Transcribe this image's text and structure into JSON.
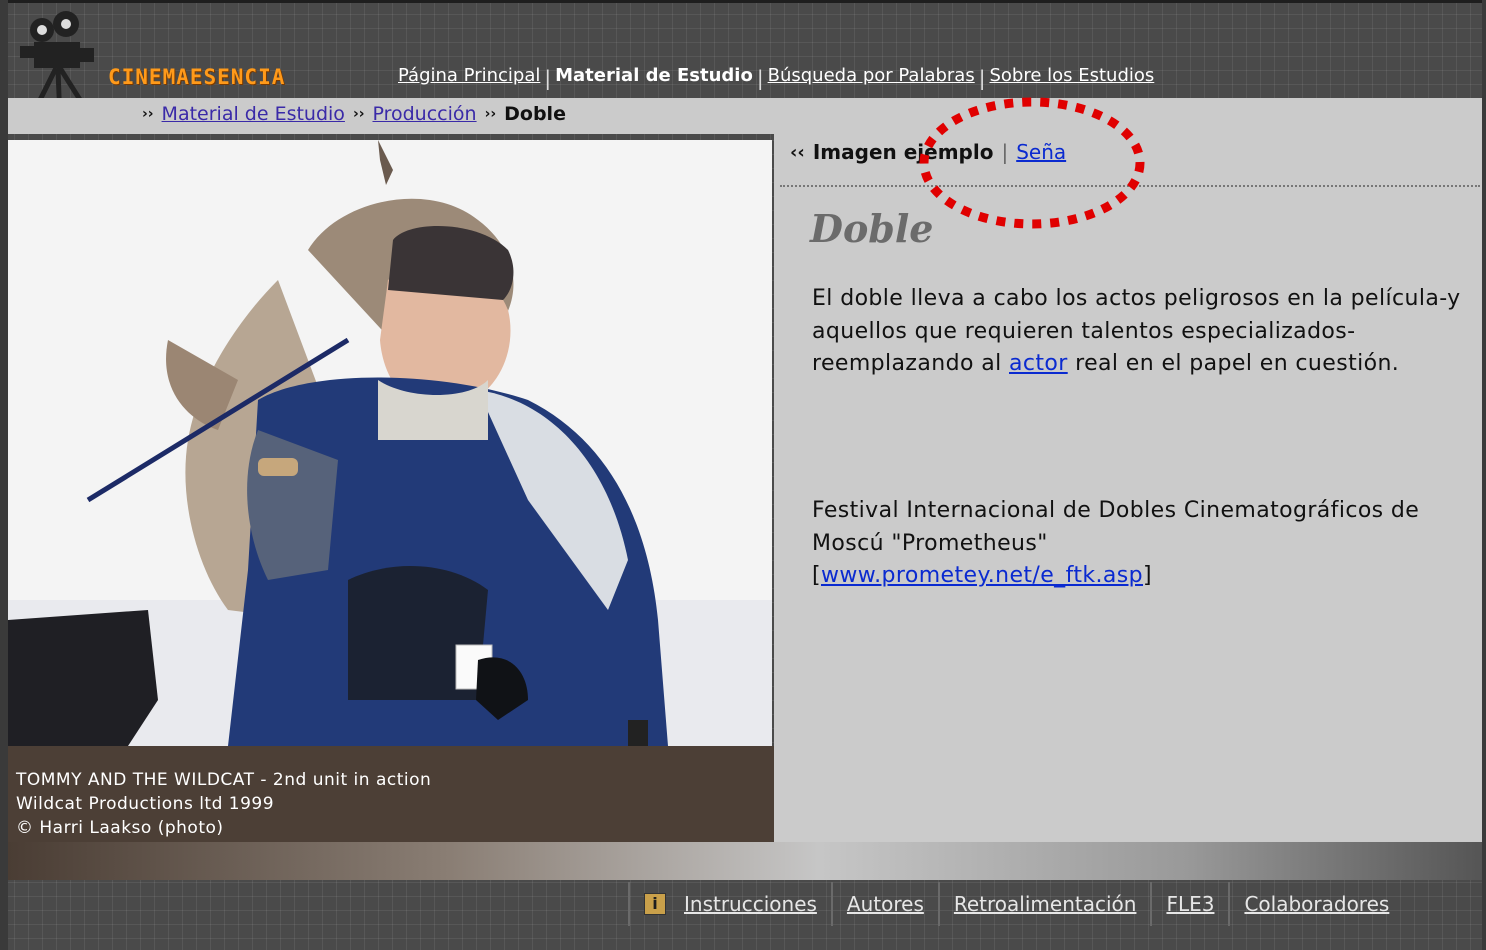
{
  "header": {
    "logo_text": "CINEMAESENCIA",
    "nav": [
      {
        "label": "Página Principal"
      },
      {
        "label": "Material de Estudio"
      },
      {
        "label": "Búsqueda por Palabras"
      },
      {
        "label": "Sobre los Estudios"
      }
    ]
  },
  "breadcrumb": {
    "items": [
      {
        "label": "Material de Estudio"
      },
      {
        "label": "Producción"
      },
      {
        "label": "Doble"
      }
    ]
  },
  "photo": {
    "caption_line1": "TOMMY AND THE WILDCAT - 2nd unit in action",
    "caption_line2": "Wildcat Productions ltd 1999",
    "caption_line3": "© Harri Laakso (photo)"
  },
  "content": {
    "tab_active": "Imagen ejemplo",
    "tab_link": "Seña",
    "title": "Doble",
    "body_before": "El doble lleva a cabo los actos peligrosos en la película-y aquellos que requieren talentos especializados-reemplazando al ",
    "body_link": "actor",
    "body_after": " real en el papel en cuestión.",
    "festival_text": "Festival Internacional de Dobles Cinematográficos de Moscú \"Prometheus\"",
    "festival_link": "www.prometey.net/e_ftk.asp"
  },
  "footer": {
    "items": [
      {
        "label": "Instrucciones",
        "icon": "info-icon"
      },
      {
        "label": "Autores"
      },
      {
        "label": "Retroalimentación"
      },
      {
        "label": "FLE3"
      },
      {
        "label": "Colaboradores"
      }
    ]
  },
  "colors": {
    "accent_orange": "#ff9a1a",
    "link_blue": "#0a2ad0",
    "annotation_red": "#e00000"
  }
}
